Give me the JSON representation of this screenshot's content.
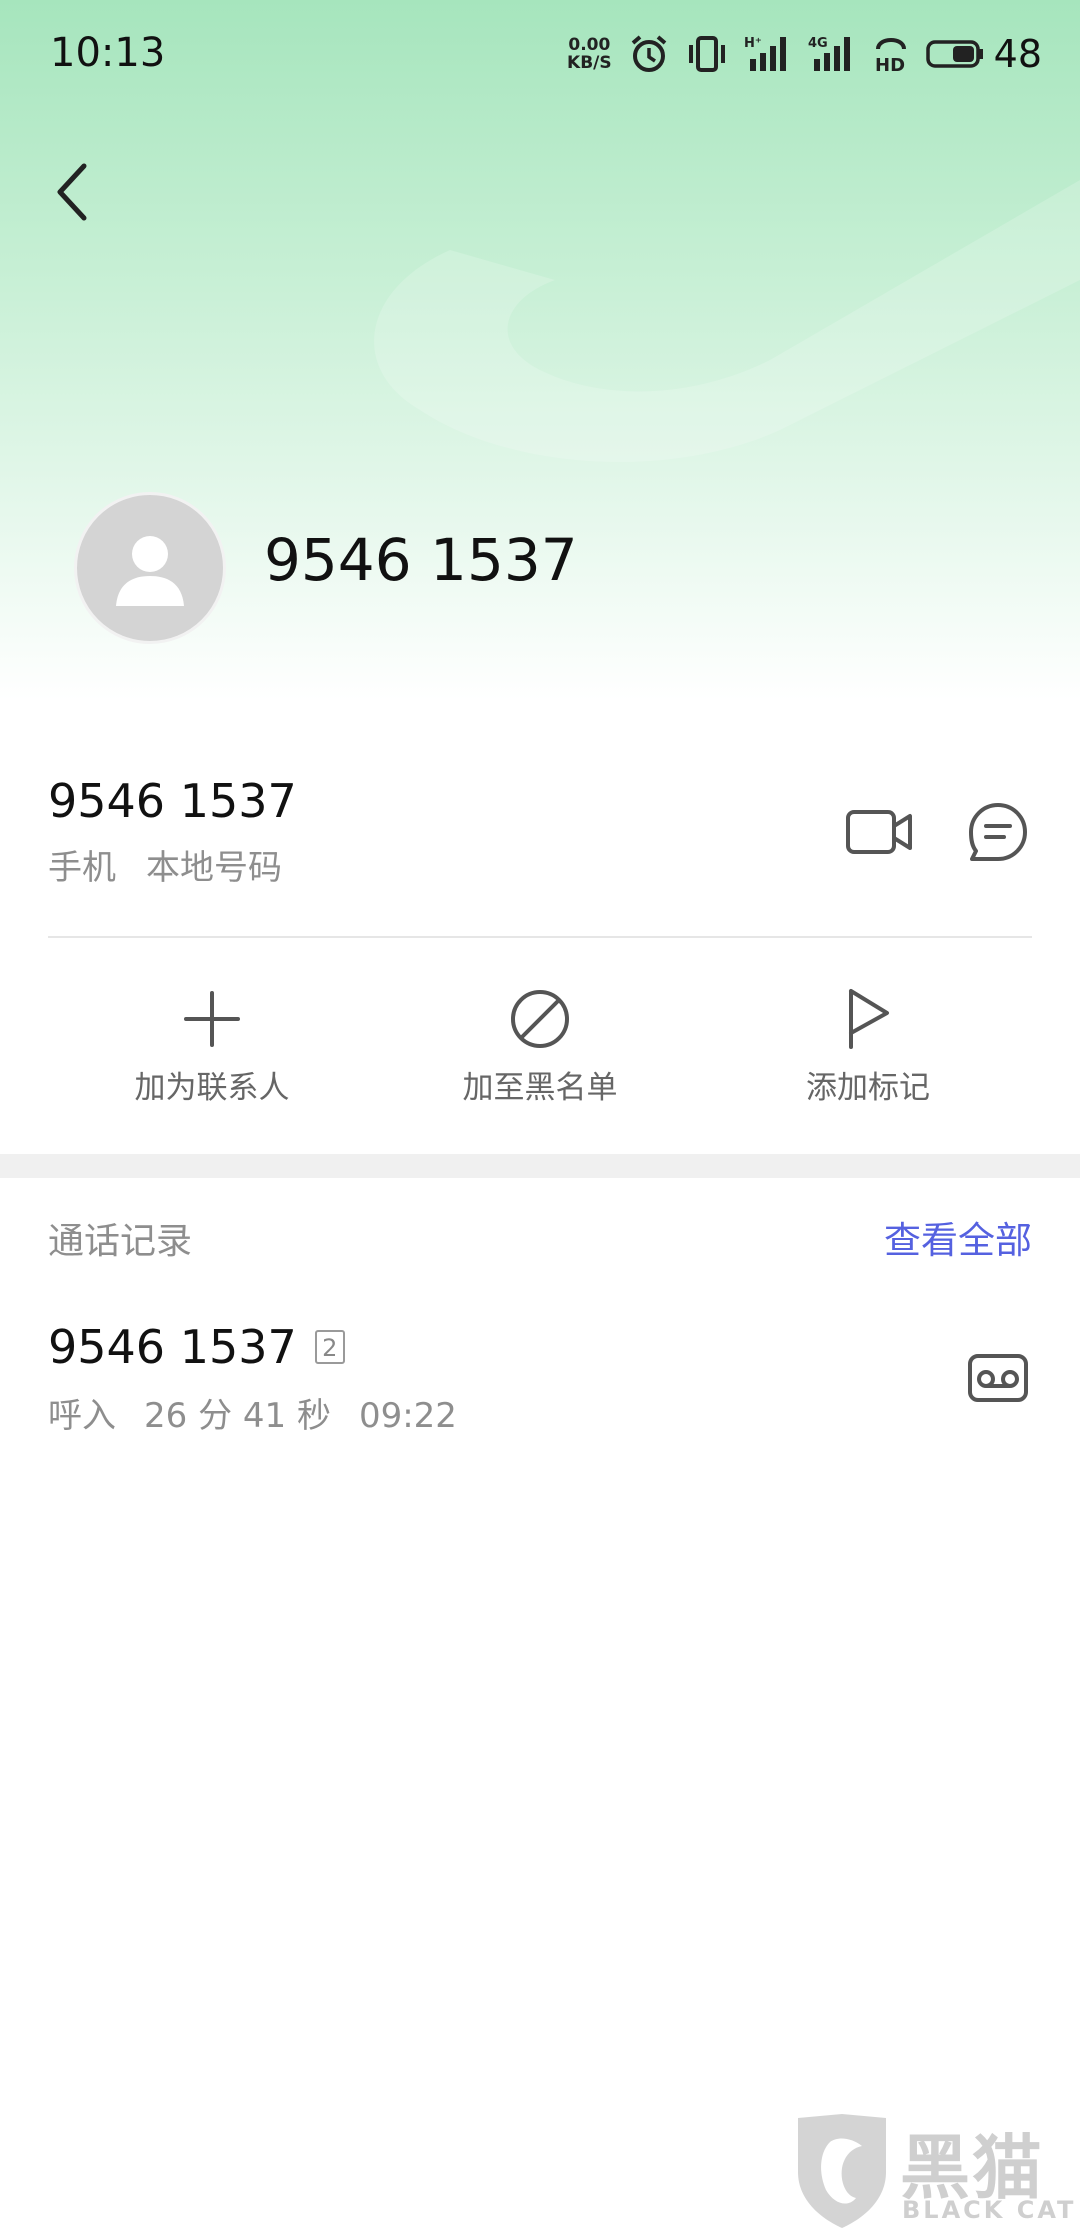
{
  "status_bar": {
    "time": "10:13",
    "net_speed_value": "0.00",
    "net_speed_unit": "KB/S",
    "battery_level": "48"
  },
  "header": {
    "title_number": "9546 1537"
  },
  "phone": {
    "number": "9546 1537",
    "type": "手机",
    "location": "本地号码"
  },
  "actions": [
    {
      "label": "加为联系人",
      "icon": "plus-icon"
    },
    {
      "label": "加至黑名单",
      "icon": "block-icon"
    },
    {
      "label": "添加标记",
      "icon": "flag-icon"
    }
  ],
  "call_log": {
    "title": "通话记录",
    "view_all": "查看全部",
    "items": [
      {
        "number": "9546 1537",
        "count": "2",
        "direction": "呼入",
        "duration": "26 分 41 秒",
        "time": "09:22"
      }
    ]
  },
  "watermark": {
    "text": "黑猫",
    "sub": "BLACK CAT"
  },
  "colors": {
    "accent": "#5561e0",
    "header_green": "#a6e5bd",
    "secondary_text": "#8e8e8e"
  }
}
